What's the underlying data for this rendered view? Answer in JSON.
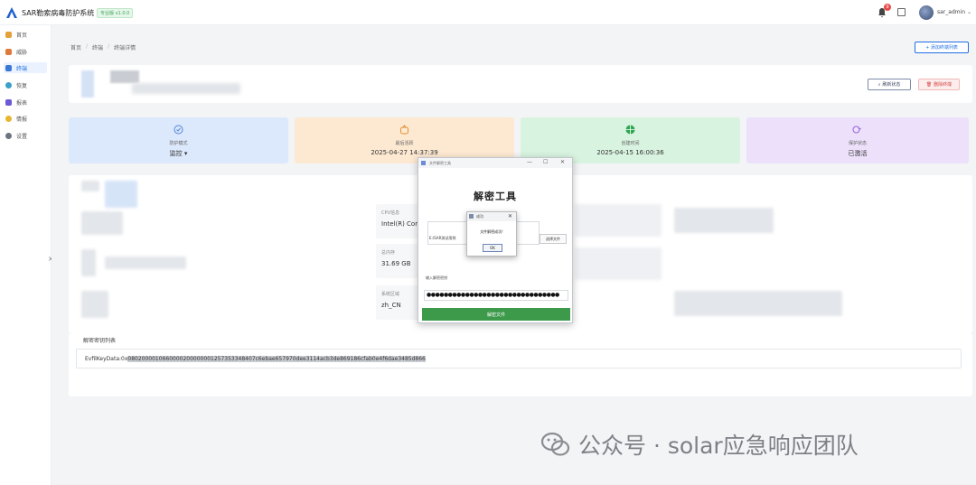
{
  "app": {
    "title": "SAR勒索病毒防护系统",
    "version": "专业版 v1.0.0"
  },
  "header": {
    "notification_count": "9",
    "username": "sar_admin",
    "caret": "⌄"
  },
  "sidebar": {
    "items": [
      {
        "label": "首页"
      },
      {
        "label": "威胁"
      },
      {
        "label": "终端"
      },
      {
        "label": "恢复"
      },
      {
        "label": "报表"
      },
      {
        "label": "情报"
      },
      {
        "label": "设置"
      }
    ],
    "collapse": "×"
  },
  "breadcrumb": [
    "首页",
    "终端",
    "终端详情"
  ],
  "breadcrumb_sep": "/",
  "add_button": "+ 添加终端列表",
  "actions": {
    "refresh": "刷新状态",
    "delete": "删除终端"
  },
  "stats": [
    {
      "label": "防护模式",
      "value": "监控 ▾",
      "color": "#dce8fb",
      "icon_color": "#4f86d8"
    },
    {
      "label": "最后活跃",
      "value": "2025-04-27 14:37:39",
      "color": "#fde9d2",
      "icon_color": "#e0902f"
    },
    {
      "label": "创建时间",
      "value": "2025-04-15 16:00:36",
      "color": "#d8f3df",
      "icon_color": "#2fa650"
    },
    {
      "label": "保护状态",
      "value": "已激活",
      "color": "#ece0fa",
      "icon_color": "#9a63d8"
    }
  ],
  "fields": [
    {
      "label": "CPU信息",
      "value": "Intel(R) Core"
    },
    {
      "label": "总内存",
      "value": "31.69 GB"
    },
    {
      "label": "系统区域",
      "value": "zh_CN"
    }
  ],
  "key_section": {
    "title": "解密密钥列表",
    "prefix": "EvfilKeyData:0x",
    "key": "0802000010660000200000001257353348407c6ebae657970dee3114acb3de869186cfab0e4f6dae3485d866"
  },
  "decrypt_window": {
    "title": "文件解密工具",
    "minimize": "—",
    "maximize": "☐",
    "close": "✕",
    "heading": "解密工具",
    "file_path": "E:/SAR测试用例",
    "browse": "选择文件",
    "password_label": "输入解密密钥",
    "password_mask": "●●●●●●●●●●●●●●●●●●●●●●●●●●●●●●●",
    "decrypt_button": "解密文件"
  },
  "dialog": {
    "title": "成功",
    "message": "文件解密成功!",
    "ok": "OK",
    "close": "✕"
  },
  "watermark": "公众号 · solar应急响应团队"
}
